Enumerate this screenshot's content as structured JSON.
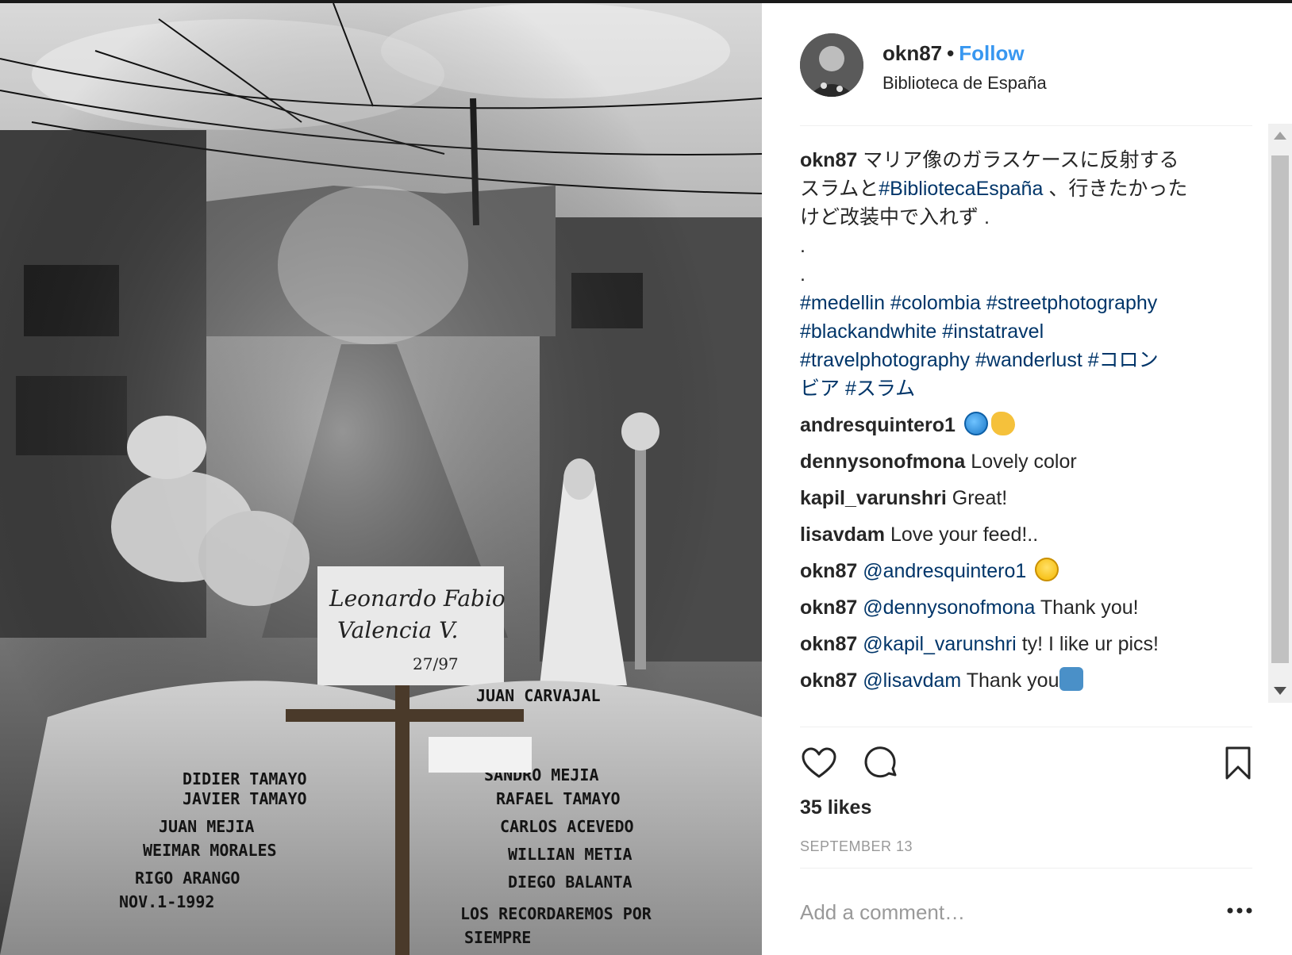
{
  "post": {
    "username": "okn87",
    "follow_label": "Follow",
    "bullet": "•",
    "location": "Biblioteca de España"
  },
  "caption": {
    "username": "okn87",
    "text_part1": "マリア像のガラスケースに反射する",
    "text_part2": "スラムと",
    "tag_main": "#BibliotecaEspaña",
    "text_part3": "、行きたかった",
    "text_part4": "けど改装中で入れず .",
    "dot1": ".",
    "dot2": ".",
    "hashtags_line1": "#medellin #colombia #streetphotography",
    "hashtags_line2": "#blackandwhite #instatravel",
    "hashtags_line3": "#travelphotography #wanderlust #コロン",
    "hashtags_line4": "ビア #スラム"
  },
  "comments": [
    {
      "user": "andresquintero1",
      "text": "",
      "emojis": [
        "globe-emoji",
        "flexed-biceps-emoji"
      ]
    },
    {
      "user": "dennysonofmona",
      "text": "Lovely color"
    },
    {
      "user": "kapil_varunshri",
      "text": "Great!"
    },
    {
      "user": "lisavdam",
      "text": "Love your feed!.."
    },
    {
      "user": "okn87",
      "mention": "@andresquintero1",
      "text": "",
      "emojis": [
        "grinning-face-emoji"
      ]
    },
    {
      "user": "okn87",
      "mention": "@dennysonofmona",
      "text": "Thank you!"
    },
    {
      "user": "okn87",
      "mention": "@kapil_varunshri",
      "text": "ty! I like ur pics!"
    },
    {
      "user": "okn87",
      "mention": "@lisavdam",
      "text": "Thank you",
      "emojis": [
        "raising-hands-emoji"
      ]
    }
  ],
  "stats": {
    "likes": "35 likes",
    "date": "SEPTEMBER 13"
  },
  "add_comment": {
    "placeholder": "Add a comment…"
  },
  "colors": {
    "link_blue": "#3897f0",
    "hashtag_blue": "#003569",
    "muted": "#999999",
    "text": "#262626"
  },
  "icons": [
    "heart-icon",
    "comment-bubble-icon",
    "bookmark-icon",
    "more-options-icon"
  ]
}
